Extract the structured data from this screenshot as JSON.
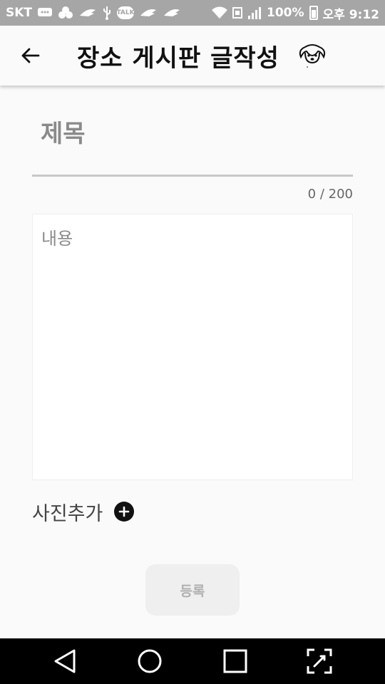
{
  "status_bar": {
    "carrier": "SKT",
    "talk_label": "TALK",
    "battery": "100%",
    "time": "오후 9:12"
  },
  "app_bar": {
    "title": "장소 게시판 글작성",
    "back_icon": "arrow-left-icon",
    "logo_icon": "dog-logo-icon"
  },
  "form": {
    "title_placeholder": "제목",
    "title_value": "",
    "char_counter": "0 / 200",
    "content_placeholder": "내용",
    "content_value": "",
    "add_photo_label": "사진추가",
    "submit_label": "등록"
  },
  "nav_bar": {
    "icons": [
      "back-triangle-icon",
      "home-circle-icon",
      "recents-square-icon",
      "screen-capture-icon"
    ]
  },
  "colors": {
    "status_bar_bg": "#a6a6a6",
    "app_bg": "#fafafa",
    "submit_bg": "#efefef",
    "submit_text": "#b0b0b0",
    "nav_bg": "#000000"
  }
}
